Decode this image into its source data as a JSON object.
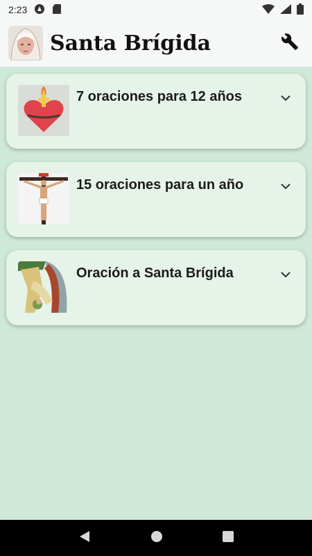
{
  "status": {
    "time": "2:23"
  },
  "app": {
    "title": "Santa Brígida"
  },
  "cards": [
    {
      "title": "7 oraciones para 12 años",
      "image": "sacred-heart-image"
    },
    {
      "title": "15 oraciones para un año",
      "image": "crucifix-image"
    },
    {
      "title": "Oración a Santa Brígida",
      "image": "pieta-painting-image"
    }
  ],
  "colors": {
    "background": "#cfe9d8",
    "card": "#e6f3e8",
    "bar": "#f6f7f7"
  }
}
